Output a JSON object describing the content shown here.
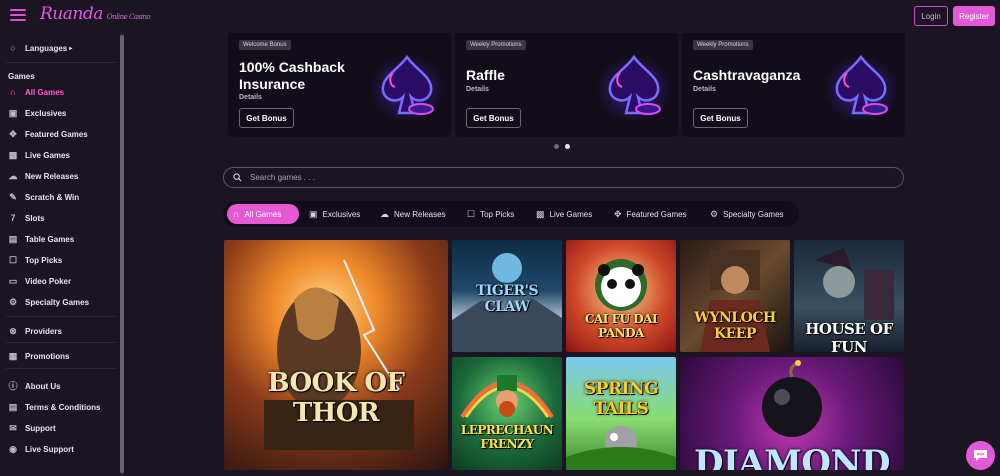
{
  "header": {
    "logo_text": "Ruanda",
    "logo_subtext": "Online Casino",
    "login_label": "Login",
    "register_label": "Register"
  },
  "sidebar": {
    "languages_label": "Languages",
    "games_heading": "Games",
    "game_items": [
      {
        "label": "All Games",
        "icon": "horseshoe-icon",
        "active": true
      },
      {
        "label": "Exclusives",
        "icon": "exclusive-icon"
      },
      {
        "label": "Featured Games",
        "icon": "puzzle-icon"
      },
      {
        "label": "Live Games",
        "icon": "live-icon"
      },
      {
        "label": "New Releases",
        "icon": "new-icon"
      },
      {
        "label": "Scratch & Win",
        "icon": "scratch-icon"
      },
      {
        "label": "Slots",
        "icon": "slots-icon"
      },
      {
        "label": "Table Games",
        "icon": "table-icon"
      },
      {
        "label": "Top Picks",
        "icon": "trophy-icon"
      },
      {
        "label": "Video Poker",
        "icon": "poker-icon"
      },
      {
        "label": "Specialty Games",
        "icon": "gear-icon"
      }
    ],
    "providers_label": "Providers",
    "promotions_label": "Promotions",
    "footer_items": [
      {
        "label": "About Us",
        "icon": "info-icon"
      },
      {
        "label": "Terms & Conditions",
        "icon": "document-icon"
      },
      {
        "label": "Support",
        "icon": "support-icon"
      },
      {
        "label": "Live Support",
        "icon": "chat-icon"
      }
    ]
  },
  "promos": [
    {
      "tag": "Welcome Bonus",
      "title_line1": "100% Cashback",
      "title_line2": "Insurance",
      "details": "Details",
      "button": "Get Bonus"
    },
    {
      "tag": "Weekly Promotions",
      "title_line1": "Raffle",
      "details": "Details",
      "button": "Get Bonus"
    },
    {
      "tag": "Weekly Promotions",
      "title_line1": "Cashtravaganza",
      "details": "Details",
      "button": "Get Bonus"
    }
  ],
  "carousel": {
    "dot_count": 2,
    "active_index": 1
  },
  "search": {
    "placeholder": "Search games . . ."
  },
  "tabs": [
    {
      "label": "All Games",
      "icon": "horseshoe-icon",
      "active": true
    },
    {
      "label": "Exclusives",
      "icon": "exclusive-icon"
    },
    {
      "label": "New Releases",
      "icon": "new-icon"
    },
    {
      "label": "Top Picks",
      "icon": "trophy-icon"
    },
    {
      "label": "Live Games",
      "icon": "live-icon"
    },
    {
      "label": "Featured Games",
      "icon": "puzzle-icon"
    },
    {
      "label": "Specialty Games",
      "icon": "gear-icon"
    }
  ],
  "games": [
    {
      "title": "BOOK OF THOR"
    },
    {
      "title": "TIGER'S CLAW"
    },
    {
      "title": "CAI FU DAI PANDA"
    },
    {
      "title": "WYNLOCH KEEP"
    },
    {
      "title": "HOUSE OF FUN"
    },
    {
      "title": "LEPRECHAUN FRENZY"
    },
    {
      "title": "SPRING TAILS"
    },
    {
      "title": "DIAMOND"
    }
  ],
  "colors": {
    "accent": "#e25ad6",
    "background": "#1a1423",
    "card": "#120d19"
  }
}
